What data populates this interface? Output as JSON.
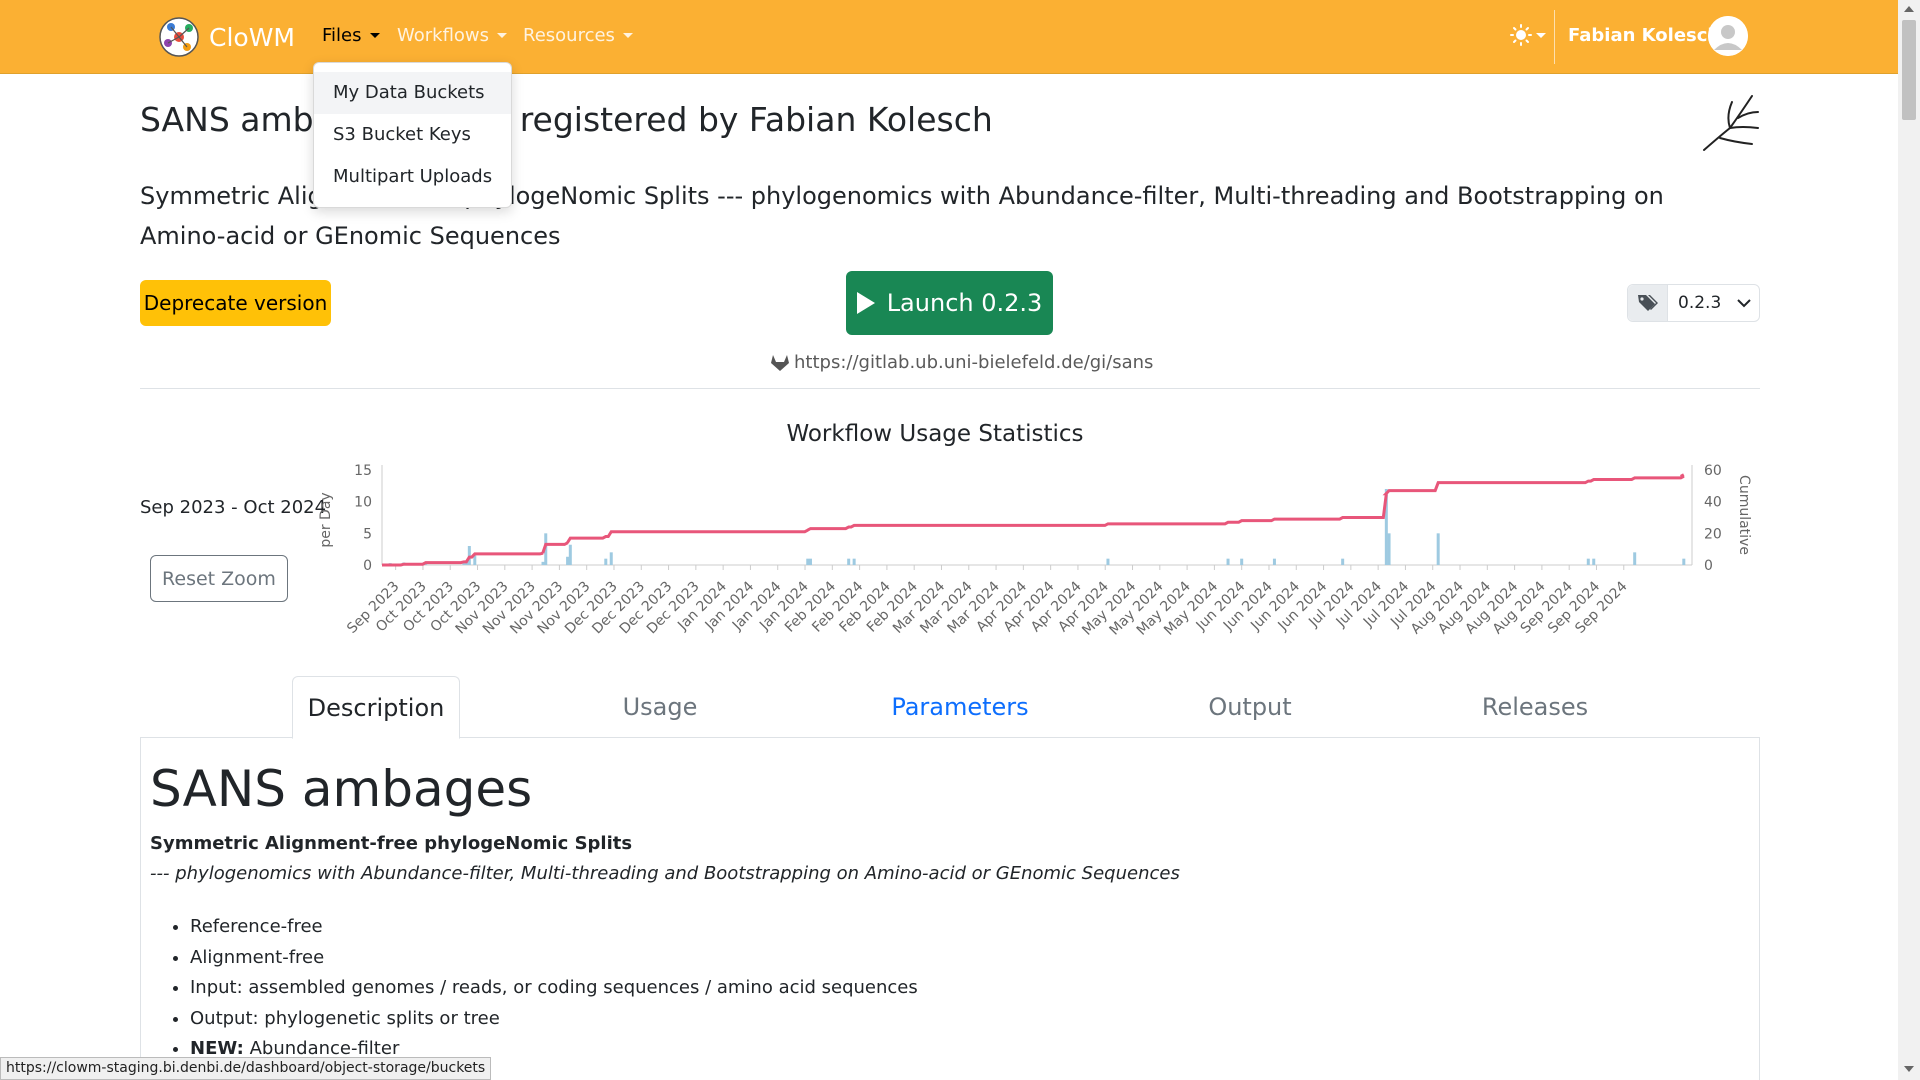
{
  "navbar": {
    "brand": "CloWM",
    "items": [
      {
        "label": "Files",
        "active": true
      },
      {
        "label": "Workflows",
        "active": false
      },
      {
        "label": "Resources",
        "active": false
      }
    ],
    "user_name": "Fabian Kolesch",
    "bg_color": "#fbb033"
  },
  "files_dropdown": {
    "items": [
      "My Data Buckets",
      "S3 Bucket Keys",
      "Multipart Uploads"
    ]
  },
  "header": {
    "title": "SANS ambages@0.2.3 registered by Fabian Kolesch",
    "subtitle": "Symmetric Alignment-free phylogeNomic Splits --- phylogenomics with Abundance-filter, Multi-threading and Bootstrapping on Amino-acid or GEnomic Sequences",
    "deprecate_label": "Deprecate version",
    "launch_label": "Launch 0.2.3",
    "version": "0.2.3",
    "repo_url": "https://gitlab.ub.uni-bielefeld.de/gi/sans"
  },
  "stats": {
    "title": "Workflow Usage Statistics",
    "date_range": "Sep 2023 - Oct 2024",
    "reset_zoom_label": "Reset Zoom"
  },
  "chart_data": {
    "type": "bar+line",
    "left_axis": {
      "label": "per Day",
      "ticks": [
        0,
        5,
        10,
        15
      ],
      "ylim": [
        0,
        15
      ]
    },
    "right_axis": {
      "label": "Cumulative",
      "ticks": [
        0,
        20,
        40,
        60
      ],
      "ylim": [
        0,
        60
      ]
    },
    "x_tick_labels": [
      "Sep 2023",
      "Oct 2023",
      "Oct 2023",
      "Oct 2023",
      "Nov 2023",
      "Nov 2023",
      "Nov 2023",
      "Nov 2023",
      "Dec 2023",
      "Dec 2023",
      "Dec 2023",
      "Dec 2023",
      "Jan 2024",
      "Jan 2024",
      "Jan 2024",
      "Jan 2024",
      "Feb 2024",
      "Feb 2024",
      "Feb 2024",
      "Feb 2024",
      "Mar 2024",
      "Mar 2024",
      "Mar 2024",
      "Apr 2024",
      "Apr 2024",
      "Apr 2024",
      "Apr 2024",
      "May 2024",
      "May 2024",
      "May 2024",
      "May 2024",
      "Jun 2024",
      "Jun 2024",
      "Jun 2024",
      "Jun 2024",
      "Jul 2024",
      "Jul 2024",
      "Jul 2024",
      "Jul 2024",
      "Aug 2024",
      "Aug 2024",
      "Aug 2024",
      "Aug 2024",
      "Sep 2024",
      "Sep 2024",
      "Sep 2024"
    ],
    "series": [
      {
        "name": "per Day",
        "color": "#9ecae1",
        "kind": "bar",
        "points": [
          [
            0.3,
            0.3
          ],
          [
            0.8,
            0.4
          ],
          [
            1.6,
            0.3
          ],
          [
            3.0,
            0.3
          ],
          [
            3.1,
            0.7
          ],
          [
            3.2,
            3.0
          ],
          [
            3.4,
            1.5
          ],
          [
            5.9,
            0.5
          ],
          [
            6.0,
            5.0
          ],
          [
            6.8,
            1.3
          ],
          [
            6.9,
            3.2
          ],
          [
            8.2,
            1.0
          ],
          [
            8.4,
            2.0
          ],
          [
            15.6,
            1.0
          ],
          [
            15.7,
            1.0
          ],
          [
            17.1,
            1.0
          ],
          [
            17.3,
            1.0
          ],
          [
            26.6,
            1.0
          ],
          [
            31.0,
            1.0
          ],
          [
            31.5,
            1.0
          ],
          [
            32.7,
            1.0
          ],
          [
            35.2,
            1.0
          ],
          [
            36.8,
            12.0
          ],
          [
            36.9,
            5.0
          ],
          [
            38.7,
            5.0
          ],
          [
            44.2,
            1.0
          ],
          [
            44.4,
            1.0
          ],
          [
            45.9,
            2.0
          ],
          [
            47.7,
            1.0
          ]
        ]
      },
      {
        "name": "Cumulative",
        "color": "#e8567a",
        "kind": "line",
        "points": [
          [
            0,
            0
          ],
          [
            0.8,
            0.5
          ],
          [
            1.6,
            1.5
          ],
          [
            3.0,
            2
          ],
          [
            3.2,
            5
          ],
          [
            3.4,
            7
          ],
          [
            5.9,
            7.5
          ],
          [
            6.0,
            13
          ],
          [
            6.8,
            14
          ],
          [
            6.9,
            17
          ],
          [
            8.2,
            18
          ],
          [
            8.4,
            21
          ],
          [
            15.6,
            22
          ],
          [
            15.7,
            23
          ],
          [
            17.1,
            24
          ],
          [
            17.3,
            25
          ],
          [
            26.6,
            26
          ],
          [
            31.0,
            27
          ],
          [
            31.5,
            28
          ],
          [
            32.7,
            29
          ],
          [
            35.2,
            30
          ],
          [
            36.8,
            45
          ],
          [
            36.9,
            47
          ],
          [
            38.7,
            52
          ],
          [
            44.2,
            53
          ],
          [
            44.4,
            54
          ],
          [
            45.9,
            55
          ],
          [
            47.7,
            56
          ],
          [
            47.7,
            57
          ]
        ]
      }
    ]
  },
  "tabs": [
    {
      "label": "Description",
      "state": "active"
    },
    {
      "label": "Usage",
      "state": "normal"
    },
    {
      "label": "Parameters",
      "state": "link"
    },
    {
      "label": "Output",
      "state": "normal"
    },
    {
      "label": "Releases",
      "state": "normal"
    }
  ],
  "description": {
    "heading": "SANS ambages",
    "strong": "Symmetric Alignment-free phylogeNomic Splits",
    "em": "--- phylogenomics with Abundance-filter, Multi-threading and Bootstrapping on Amino-acid or GEnomic Sequences",
    "bullets": [
      {
        "prefix": "",
        "text": "Reference-free"
      },
      {
        "prefix": "",
        "text": "Alignment-free"
      },
      {
        "prefix": "",
        "text": "Input: assembled genomes / reads, or coding sequences / amino acid sequences"
      },
      {
        "prefix": "",
        "text": "Output: phylogenetic splits or tree"
      },
      {
        "prefix": "NEW:",
        "text": " Abundance-filter"
      }
    ]
  },
  "status_bar": "https://clowm-staging.bi.denbi.de/dashboard/object-storage/buckets"
}
